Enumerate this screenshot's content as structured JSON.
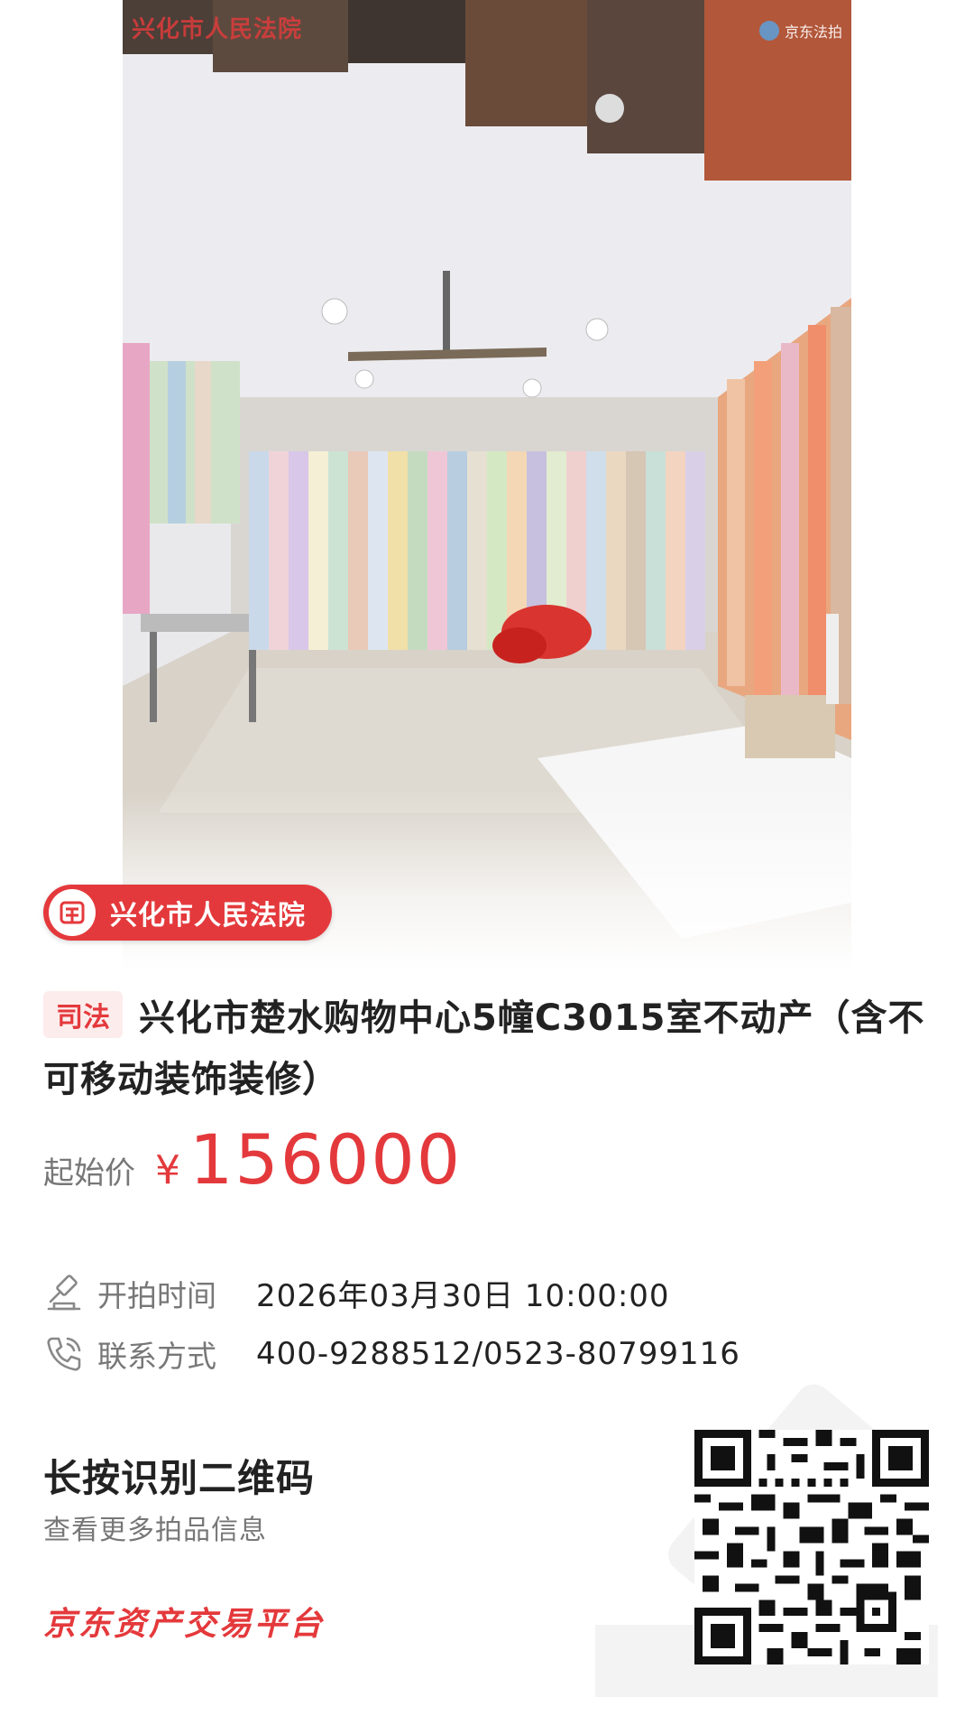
{
  "photo": {
    "watermark_court": "兴化市人民法院",
    "watermark_brand": "京东法拍"
  },
  "court_badge": {
    "label": "兴化市人民法院"
  },
  "listing": {
    "tag": "司法",
    "title": "兴化市楚水购物中心5幢C3015室不动产（含不可移动装饰装修）"
  },
  "price": {
    "label": "起始价",
    "currency": "¥",
    "value": "156000"
  },
  "info": {
    "start_time_label": "开拍时间",
    "start_time_value": "2026年03月30日 10:00:00",
    "contact_label": "联系方式",
    "contact_value": "400-9288512/0523-80799116"
  },
  "qr_section": {
    "title": "长按识别二维码",
    "subtitle": "查看更多拍品信息",
    "platform": "京东资产交易平台"
  },
  "colors": {
    "accent": "#e4393c",
    "text_primary": "#222222",
    "text_secondary": "#777777",
    "tag_bg": "#fdecec"
  },
  "icons": {
    "court": "court-emblem-icon",
    "start_time": "gavel-icon",
    "contact": "phone-icon"
  }
}
